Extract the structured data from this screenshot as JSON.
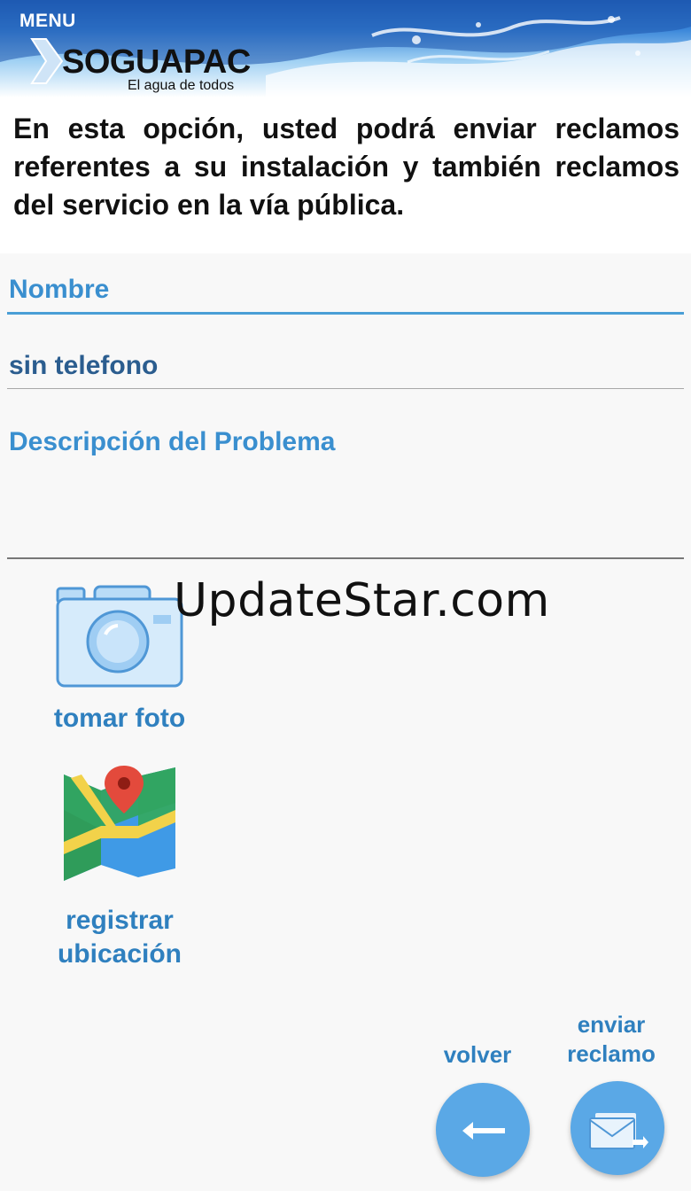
{
  "header": {
    "menu_label": "MENU",
    "logo_text": "SOGUAPAC",
    "logo_tagline": "El agua de todos"
  },
  "intro_text": "En esta opción, usted podrá enviar reclamos referentes a su instalación y también reclamos del servicio en la vía pública.",
  "form": {
    "nombre_placeholder": "Nombre",
    "telefono_value": "sin telefono",
    "descripcion_placeholder": "Descripción del Problema"
  },
  "actions": {
    "foto_label": "tomar foto",
    "ubicacion_label": "registrar ubicación"
  },
  "buttons": {
    "volver_label": "volver",
    "enviar_label": "enviar reclamo"
  },
  "watermark": "UpdateStar.com",
  "colors": {
    "accent": "#3a8fcf",
    "fab": "#5aa8e6",
    "value_text": "#2b5d8f"
  }
}
